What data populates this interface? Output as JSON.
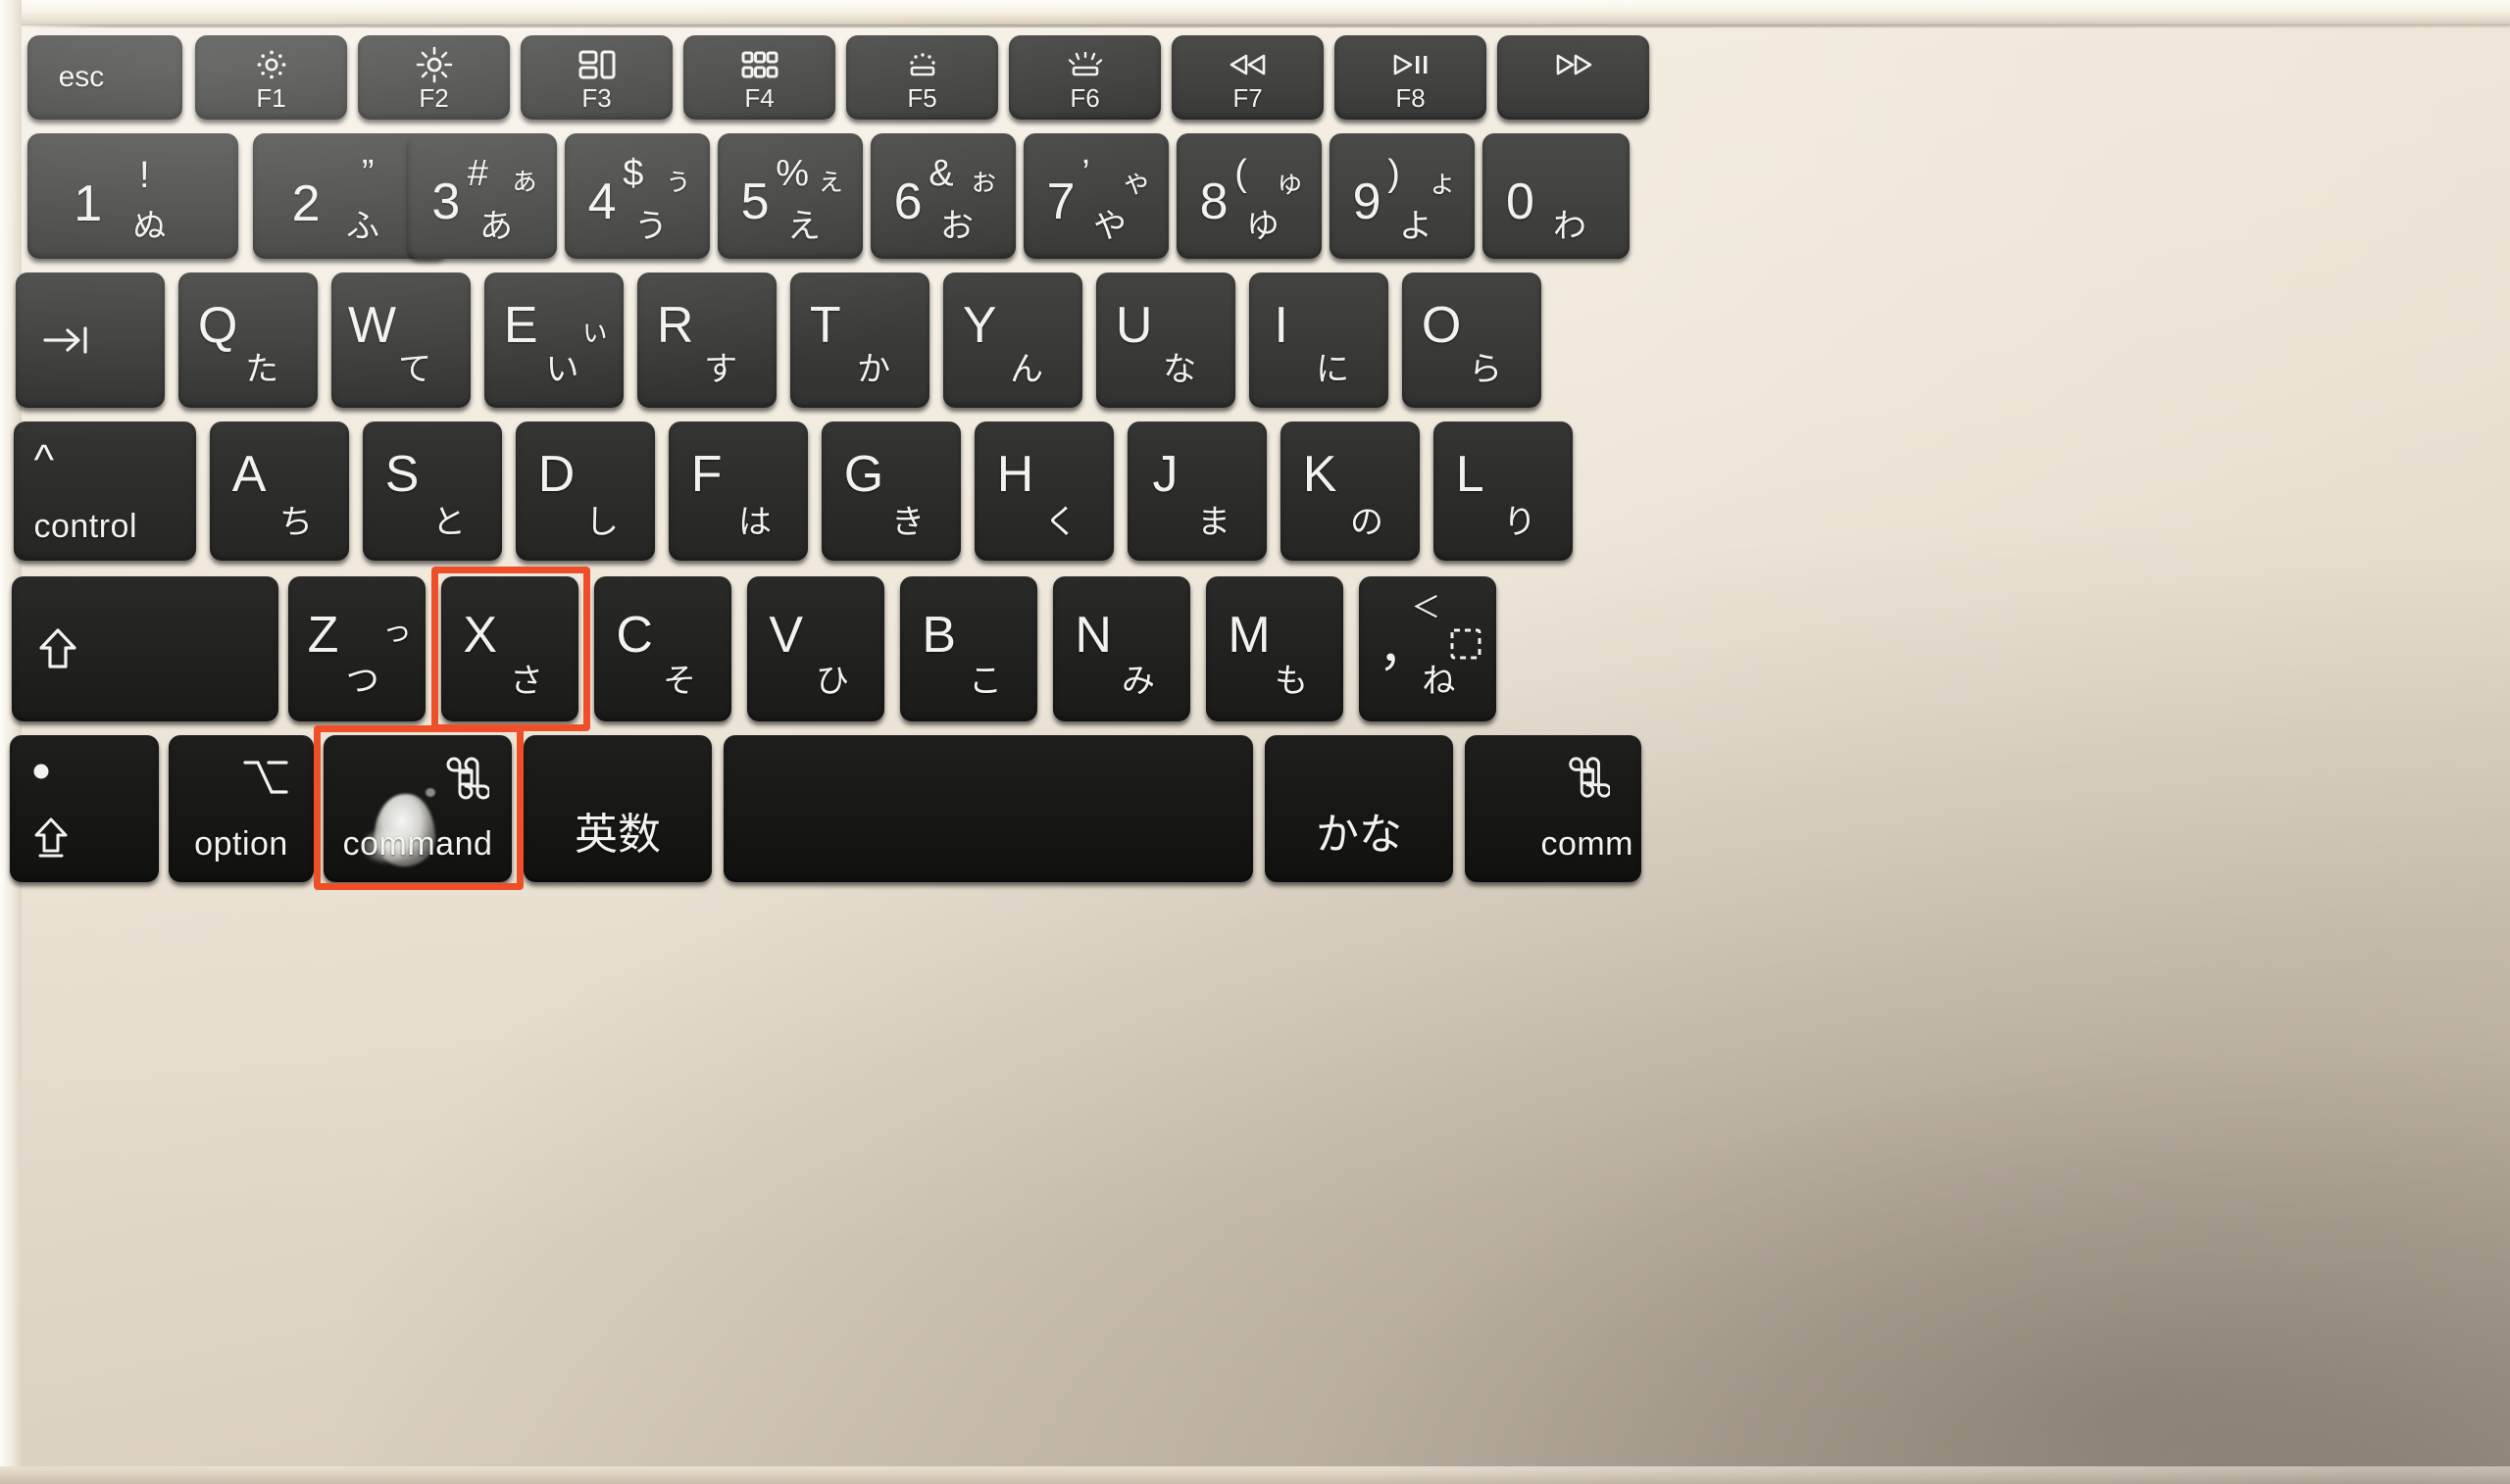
{
  "scene": {
    "subject": "Apple Magic Keyboard (Japanese JIS layout) close-up photograph",
    "annotation_purpose": "Red rectangles highlight the Command and X keys (Cmd+X cut shortcut)",
    "highlight_color": "#ef4f28",
    "deck_color": "#e9e0d1",
    "key_color": "#3f3f3d",
    "legend_color": "#f2f2ef"
  },
  "rows": {
    "function_row": [
      {
        "id": "esc",
        "primary": "esc",
        "icon": "",
        "sub": "",
        "kind": "word"
      },
      {
        "id": "f1",
        "primary": "",
        "icon": "brightness-down-icon",
        "sub": "F1",
        "kind": "icon"
      },
      {
        "id": "f2",
        "primary": "",
        "icon": "brightness-up-icon",
        "sub": "F2",
        "kind": "icon"
      },
      {
        "id": "f3",
        "primary": "",
        "icon": "mission-control-icon",
        "sub": "F3",
        "kind": "icon"
      },
      {
        "id": "f4",
        "primary": "",
        "icon": "launchpad-icon",
        "sub": "F4",
        "kind": "icon"
      },
      {
        "id": "f5",
        "primary": "",
        "icon": "keyboard-backlight-down-icon",
        "sub": "F5",
        "kind": "icon"
      },
      {
        "id": "f6",
        "primary": "",
        "icon": "keyboard-backlight-up-icon",
        "sub": "F6",
        "kind": "icon"
      },
      {
        "id": "f7",
        "primary": "",
        "icon": "rewind-icon",
        "sub": "F7",
        "kind": "icon"
      },
      {
        "id": "f8",
        "primary": "",
        "icon": "play-pause-icon",
        "sub": "F8",
        "kind": "icon"
      },
      {
        "id": "f9",
        "primary": "",
        "icon": "fast-forward-icon",
        "sub": "",
        "kind": "icon"
      }
    ],
    "number_row": [
      {
        "id": "n1",
        "shift": "!",
        "main": "1",
        "kana_tr": "",
        "kana_br": "ぬ"
      },
      {
        "id": "n2",
        "shift": "”",
        "main": "2",
        "kana_tr": "",
        "kana_br": "ふ"
      },
      {
        "id": "n3",
        "shift": "#",
        "main": "3",
        "kana_tr": "ぁ",
        "kana_br": "あ"
      },
      {
        "id": "n4",
        "shift": "$",
        "main": "4",
        "kana_tr": "ぅ",
        "kana_br": "う"
      },
      {
        "id": "n5",
        "shift": "%",
        "main": "5",
        "kana_tr": "ぇ",
        "kana_br": "え"
      },
      {
        "id": "n6",
        "shift": "&",
        "main": "6",
        "kana_tr": "ぉ",
        "kana_br": "お"
      },
      {
        "id": "n7",
        "shift": "’",
        "main": "7",
        "kana_tr": "ゃ",
        "kana_br": "や"
      },
      {
        "id": "n8",
        "shift": "(",
        "main": "8",
        "kana_tr": "ゅ",
        "kana_br": "ゆ"
      },
      {
        "id": "n9",
        "shift": ")",
        "main": "9",
        "kana_tr": "ょ",
        "kana_br": "よ"
      },
      {
        "id": "n0",
        "shift": "",
        "main": "0",
        "kana_tr": "",
        "kana_br": "わ"
      }
    ],
    "top_letter_row": [
      {
        "id": "tab",
        "main": "tab-arrow-icon",
        "kana": "",
        "kind": "icon"
      },
      {
        "id": "q",
        "main": "Q",
        "kana": "た"
      },
      {
        "id": "w",
        "main": "W",
        "kana": "て"
      },
      {
        "id": "e",
        "main": "E",
        "kana": "い",
        "kana_small": "ぃ"
      },
      {
        "id": "r",
        "main": "R",
        "kana": "す"
      },
      {
        "id": "t",
        "main": "T",
        "kana": "か"
      },
      {
        "id": "y",
        "main": "Y",
        "kana": "ん"
      },
      {
        "id": "u",
        "main": "U",
        "kana": "な"
      },
      {
        "id": "i",
        "main": "I",
        "kana": "に"
      },
      {
        "id": "o",
        "main": "O",
        "kana": "ら"
      }
    ],
    "home_row": [
      {
        "id": "control",
        "symbol": "^",
        "word": "control",
        "kind": "mod"
      },
      {
        "id": "a",
        "main": "A",
        "kana": "ち"
      },
      {
        "id": "s",
        "main": "S",
        "kana": "と"
      },
      {
        "id": "d",
        "main": "D",
        "kana": "し"
      },
      {
        "id": "f",
        "main": "F",
        "kana": "は"
      },
      {
        "id": "g",
        "main": "G",
        "kana": "き"
      },
      {
        "id": "h",
        "main": "H",
        "kana": "く"
      },
      {
        "id": "j",
        "main": "J",
        "kana": "ま"
      },
      {
        "id": "k",
        "main": "K",
        "kana": "の"
      },
      {
        "id": "l",
        "main": "L",
        "kana": "り"
      }
    ],
    "bottom_letter_row": [
      {
        "id": "shift",
        "main": "shift-arrow-icon",
        "kind": "icon"
      },
      {
        "id": "z",
        "main": "Z",
        "kana": "つ",
        "kana_small": "っ"
      },
      {
        "id": "x",
        "main": "X",
        "kana": "さ",
        "highlighted": true
      },
      {
        "id": "c",
        "main": "C",
        "kana": "そ"
      },
      {
        "id": "v",
        "main": "V",
        "kana": "ひ"
      },
      {
        "id": "b",
        "main": "B",
        "kana": "こ"
      },
      {
        "id": "n",
        "main": "N",
        "kana": "み"
      },
      {
        "id": "m",
        "main": "M",
        "kana": "も"
      },
      {
        "id": "comma",
        "shift": "＜",
        "main": "，",
        "kana": "ね",
        "kana_small": "dotted-box-icon"
      }
    ],
    "modifier_row": [
      {
        "id": "fn",
        "symbol": "fn-dot-icon",
        "word": "globe-icon",
        "kind": "mod"
      },
      {
        "id": "option",
        "symbol": "⌥",
        "word": "option",
        "kind": "mod"
      },
      {
        "id": "command",
        "symbol": "⌘",
        "word": "command",
        "kind": "mod",
        "highlighted": true,
        "wear": true
      },
      {
        "id": "eisu",
        "symbol": "",
        "word": "英数",
        "kind": "jp"
      },
      {
        "id": "space",
        "symbol": "",
        "word": "",
        "kind": "space"
      },
      {
        "id": "kana",
        "symbol": "",
        "word": "かな",
        "kind": "jp"
      },
      {
        "id": "command-right",
        "symbol": "⌘",
        "word": "comm",
        "kind": "mod"
      }
    ]
  },
  "highlights": [
    {
      "target": "x-key",
      "label": "X key highlight"
    },
    {
      "target": "command-key",
      "label": "Command key highlight"
    }
  ]
}
